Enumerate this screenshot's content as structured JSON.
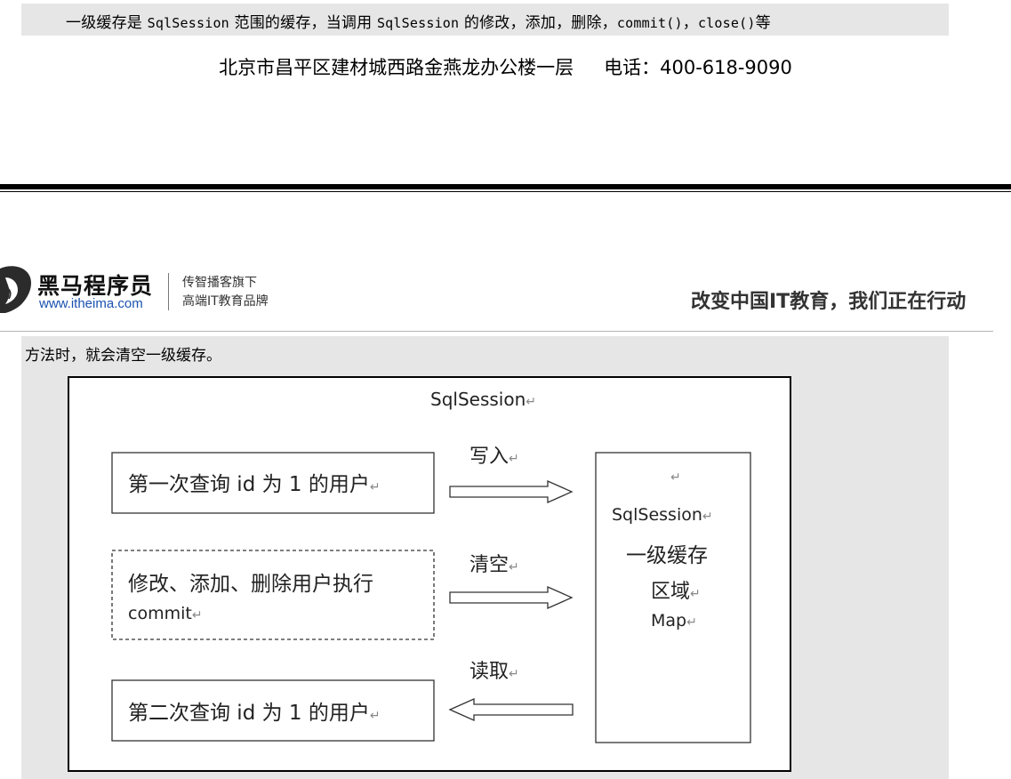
{
  "doc": {
    "top_line": {
      "t1": "一级缓存是",
      "c1": "SqlSession",
      "t2": "范围的缓存，当调用",
      "c2": "SqlSession",
      "t3": "的修改，添加，删除，",
      "c3": "commit()",
      "t4": "，",
      "c4": "close()",
      "t5": "等"
    },
    "footer": {
      "address": "北京市昌平区建材城西路金燕龙办公楼一层",
      "phone": "电话：400-618-9090"
    },
    "header": {
      "brand_name": "黑马程序员",
      "brand_url": "www.itheima.com",
      "tagline_1": "传智播客旗下",
      "tagline_2": "高端IT教育品牌",
      "slogan": "改变中国IT教育，我们正在行动"
    },
    "content_line": "方法时，就会清空一级缓存。",
    "diagram": {
      "title": "SqlSession",
      "box_query_1": "第一次查询 id 为 1 的用户",
      "box_modify_line1": "修改、添加、删除用户执行",
      "box_modify_line2": "commit",
      "box_query_2": "第二次查询 id 为 1 的用户",
      "label_write": "写入",
      "label_clear": "清空",
      "label_read": "读取",
      "cache_line1": "SqlSession",
      "cache_line2": "一级缓存",
      "cache_line3": "区域",
      "cache_line4": "Map",
      "return_mark": "↵"
    }
  }
}
